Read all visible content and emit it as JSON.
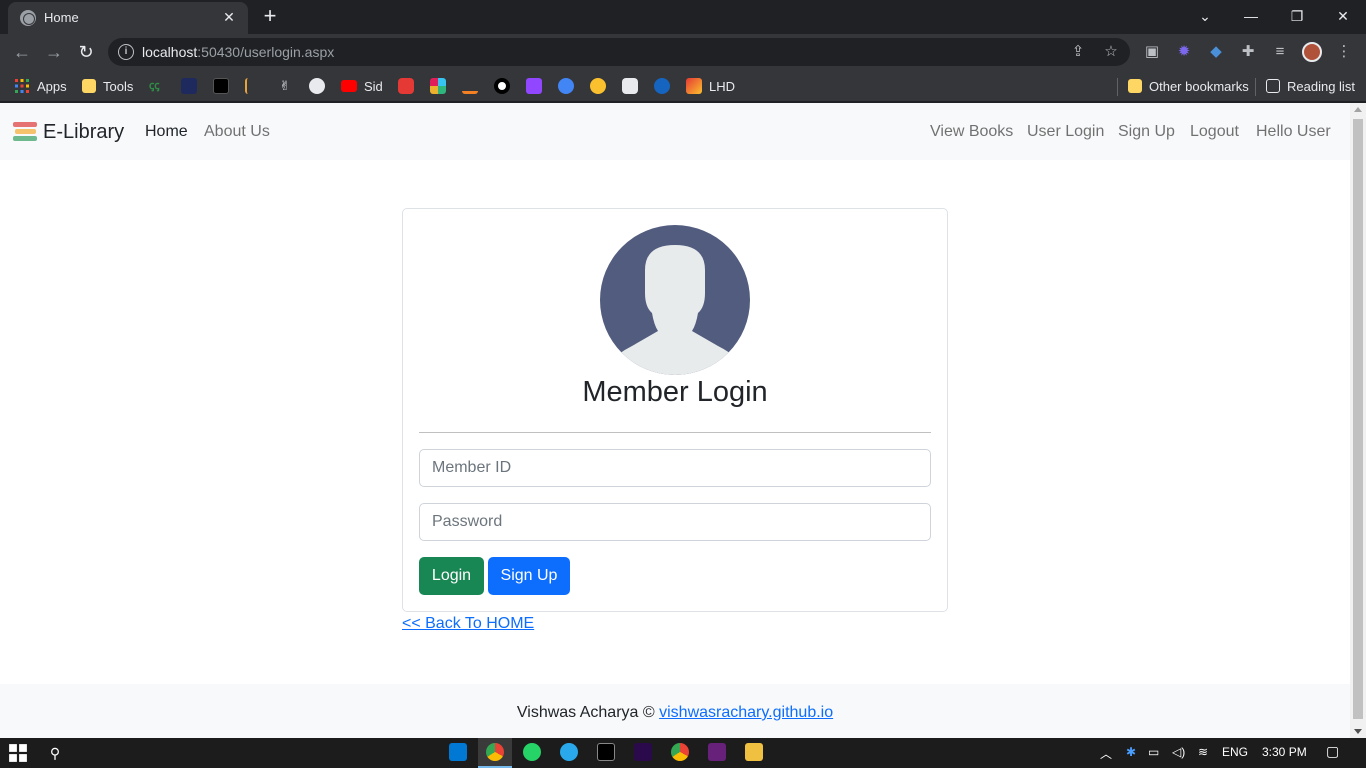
{
  "browser": {
    "tab_title": "Home",
    "tab_close": "✕",
    "new_tab": "+",
    "window_controls": {
      "minimize": "—",
      "restore": "❐",
      "close": "✕",
      "tab_search": "⌄"
    },
    "url_host": "localhost",
    "url_rest": ":50430/userlogin.aspx",
    "nav": {
      "back": "←",
      "forward": "→",
      "reload": "↻"
    },
    "bookmarks": {
      "apps": "Apps",
      "tools": "Tools",
      "sid": "Sid",
      "lhd": "LHD",
      "other": "Other bookmarks",
      "reading_list": "Reading list"
    }
  },
  "navbar": {
    "brand": "E-Library",
    "left_links": [
      "Home",
      "About Us"
    ],
    "right_links": [
      "View Books",
      "User Login",
      "Sign Up",
      "Logout",
      "Hello User"
    ]
  },
  "login_card": {
    "title": "Member Login",
    "member_id_placeholder": "Member ID",
    "password_placeholder": "Password",
    "login_label": "Login",
    "signup_label": "Sign Up"
  },
  "back_link": "<< Back To HOME",
  "footer": {
    "text": "Vishwas Acharya © ",
    "link": "vishwasrachary.github.io"
  },
  "taskbar": {
    "language": "ENG",
    "time": "3:30 PM"
  },
  "colors": {
    "success": "#198754",
    "primary": "#0d6efd",
    "avatar": "#525c7e",
    "navbar_bg": "#f8f9fa"
  }
}
